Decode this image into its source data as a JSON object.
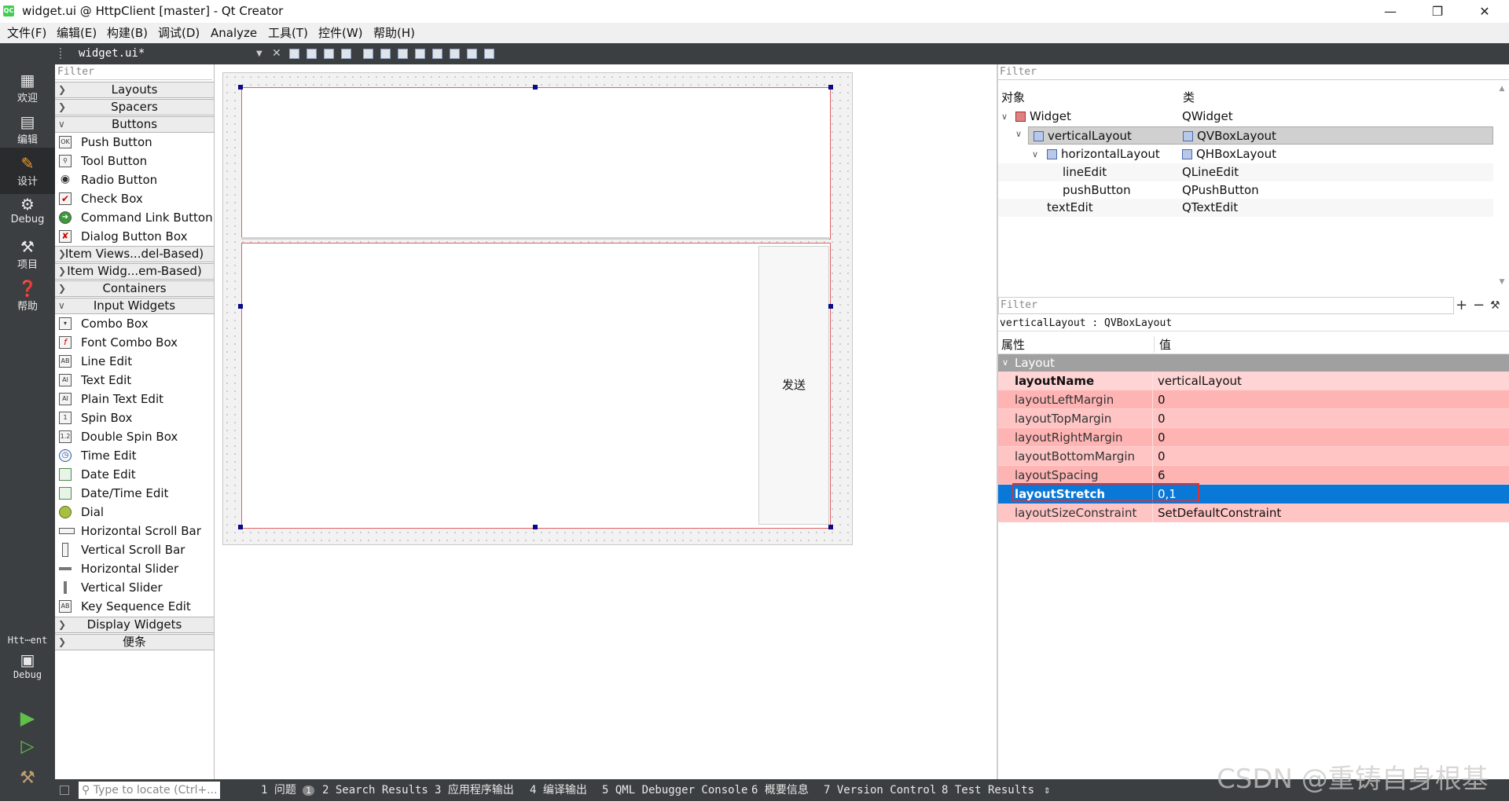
{
  "window": {
    "title": "widget.ui @ HttpClient [master] - Qt Creator",
    "app_icon": "QC"
  },
  "menu": [
    "文件(F)",
    "编辑(E)",
    "构建(B)",
    "调试(D)",
    "Analyze",
    "工具(T)",
    "控件(W)",
    "帮助(H)"
  ],
  "editor_tab": {
    "file": "widget.ui*"
  },
  "modes": [
    {
      "label": "欢迎",
      "icon": "grid-icon"
    },
    {
      "label": "编辑",
      "icon": "edit-icon"
    },
    {
      "label": "设计",
      "icon": "design-icon"
    },
    {
      "label": "Debug",
      "icon": "bug-icon"
    },
    {
      "label": "项目",
      "icon": "wrench-icon"
    },
    {
      "label": "帮助",
      "icon": "help-icon"
    }
  ],
  "kit": {
    "project": "Htt⋯ent",
    "config": "Debug"
  },
  "widget_box": {
    "filter": "Filter",
    "categories": {
      "layouts": "Layouts",
      "spacers": "Spacers",
      "buttons": "Buttons",
      "item_views": "Item Views...del-Based)",
      "item_widgets": "Item Widg...em-Based)",
      "containers": "Containers",
      "input_widgets": "Input Widgets",
      "display_widgets": "Display Widgets",
      "notes": "便条"
    },
    "buttons": [
      "Push Button",
      "Tool Button",
      "Radio Button",
      "Check Box",
      "Command Link Button",
      "Dialog Button Box"
    ],
    "inputs": [
      "Combo Box",
      "Font Combo Box",
      "Line Edit",
      "Text Edit",
      "Plain Text Edit",
      "Spin Box",
      "Double Spin Box",
      "Time Edit",
      "Date Edit",
      "Date/Time Edit",
      "Dial",
      "Horizontal Scroll Bar",
      "Vertical Scroll Bar",
      "Horizontal Slider",
      "Vertical Slider",
      "Key Sequence Edit"
    ]
  },
  "form": {
    "send_button": "发送"
  },
  "object_inspector": {
    "filter": "Filter",
    "col_object": "对象",
    "col_class": "类",
    "rows": [
      {
        "name": "Widget",
        "cls": "QWidget"
      },
      {
        "name": "verticalLayout",
        "cls": "QVBoxLayout"
      },
      {
        "name": "horizontalLayout",
        "cls": "QHBoxLayout"
      },
      {
        "name": "lineEdit",
        "cls": "QLineEdit"
      },
      {
        "name": "pushButton",
        "cls": "QPushButton"
      },
      {
        "name": "textEdit",
        "cls": "QTextEdit"
      }
    ]
  },
  "property_editor": {
    "filter": "Filter",
    "subject": "verticalLayout : QVBoxLayout",
    "col_property": "属性",
    "col_value": "值",
    "group": "Layout",
    "rows": [
      {
        "name": "layoutName",
        "value": "verticalLayout"
      },
      {
        "name": "layoutLeftMargin",
        "value": "0"
      },
      {
        "name": "layoutTopMargin",
        "value": "0"
      },
      {
        "name": "layoutRightMargin",
        "value": "0"
      },
      {
        "name": "layoutBottomMargin",
        "value": "0"
      },
      {
        "name": "layoutSpacing",
        "value": "6"
      },
      {
        "name": "layoutStretch",
        "value": "0,1"
      },
      {
        "name": "layoutSizeConstraint",
        "value": "SetDefaultConstraint"
      }
    ]
  },
  "status_bar": {
    "locate_placeholder": "Type to locate (Ctrl+...",
    "tabs": [
      "1 问题",
      "2 Search Results",
      "3 应用程序输出",
      "4 编译输出",
      "5 QML Debugger Console",
      "6 概要信息",
      "7 Version Control",
      "8 Test Results"
    ],
    "issues_badge": "1"
  },
  "watermark": "CSDN @重铸自身根基",
  "colors": {
    "dark": "#3c3f41",
    "selection": "#0a78d7",
    "changed_property": "#ffb4b4",
    "highlight_box": "#e03030"
  }
}
